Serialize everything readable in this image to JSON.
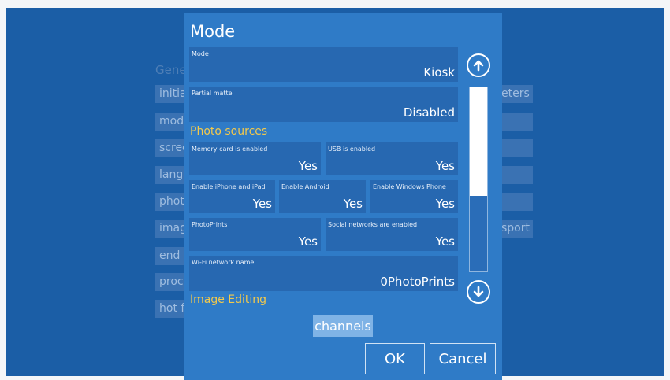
{
  "background": {
    "general_label": "Gene",
    "left_tiles": [
      "initia",
      "mod",
      "scree",
      "langu",
      "phot",
      "imag",
      "end",
      "proc",
      "hot f"
    ],
    "right_tiles": [
      "eters",
      "sport"
    ]
  },
  "dialog": {
    "title": "Mode",
    "fields": {
      "mode": {
        "label": "Mode",
        "value": "Kiosk"
      },
      "partial_matte": {
        "label": "Partial matte",
        "value": "Disabled"
      },
      "memory_card": {
        "label": "Memory card is enabled",
        "value": "Yes"
      },
      "usb": {
        "label": "USB is enabled",
        "value": "Yes"
      },
      "iphone": {
        "label": "Enable iPhone and iPad",
        "value": "Yes"
      },
      "android": {
        "label": "Enable Android",
        "value": "Yes"
      },
      "windows_phone": {
        "label": "Enable Windows Phone",
        "value": "Yes"
      },
      "photoprints": {
        "label": "PhotoPrints",
        "value": "Yes"
      },
      "social": {
        "label": "Social networks are enabled",
        "value": "Yes"
      },
      "wifi": {
        "label": "Wi-Fi network name",
        "value": "0PhotoPrints"
      }
    },
    "sections": {
      "photo_sources": "Photo sources",
      "image_editing": "Image Editing"
    },
    "channels_label": "channels",
    "ok_label": "OK",
    "cancel_label": "Cancel",
    "scroll_position": 0.0
  },
  "colors": {
    "background": "#1b5ea6",
    "dialog": "#2f7bc7",
    "field": "#2768b1",
    "section_text": "#f2c94c",
    "channels_button": "#7fb3e6"
  },
  "icons": {
    "scroll_up": "arrow-up-circle-icon",
    "scroll_down": "arrow-down-circle-icon"
  }
}
